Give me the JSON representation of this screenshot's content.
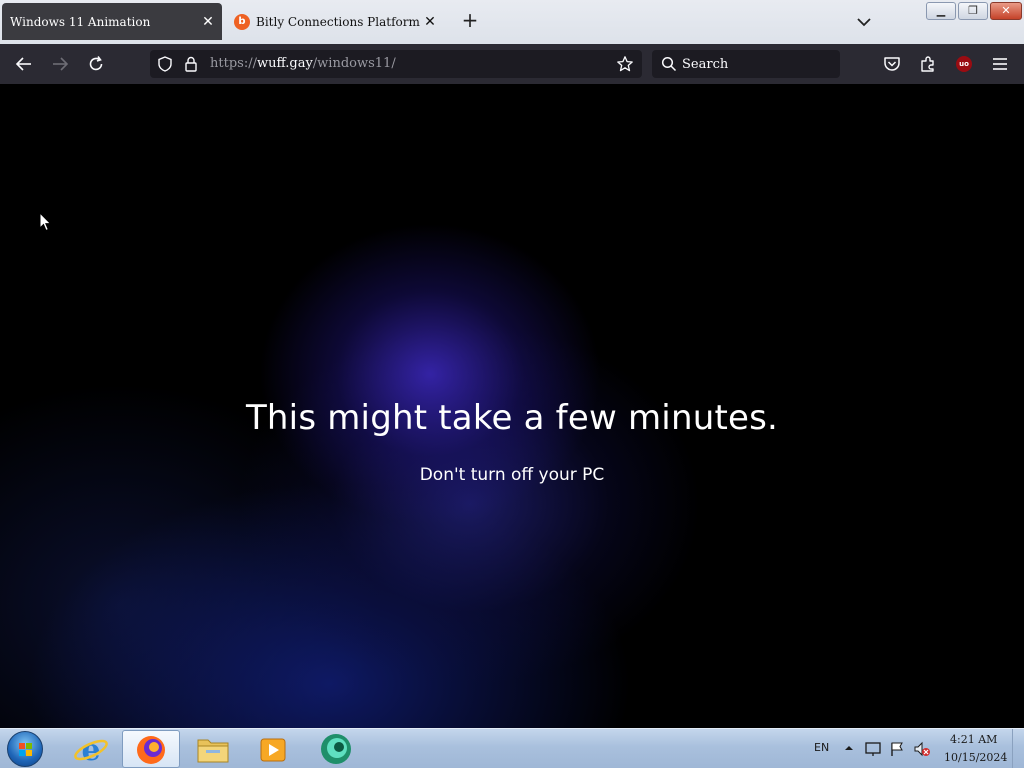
{
  "browser": {
    "tabs": [
      {
        "title": "Windows 11 Animation",
        "active": true
      },
      {
        "title": "Bitly Connections Platform | Shor",
        "active": false,
        "favicon": "bitly-icon"
      }
    ],
    "url": {
      "scheme": "https://",
      "host": "wuff.gay",
      "path": "/windows11/"
    },
    "search_placeholder": "Search"
  },
  "page": {
    "headline": "This might take a few minutes.",
    "subline": "Don't turn off your PC"
  },
  "taskbar": {
    "apps": [
      "internet-explorer-icon",
      "firefox-icon",
      "file-explorer-icon",
      "media-player-icon",
      "app-icon"
    ],
    "language": "EN",
    "time": "4:21 AM",
    "date": "10/15/2024"
  },
  "colors": {
    "tab_active_bg": "#3b3b40",
    "navbar_bg": "#2b2a33",
    "page_bg": "#000000",
    "glow": "#3c28be",
    "taskbar": "#a9c0dd"
  }
}
